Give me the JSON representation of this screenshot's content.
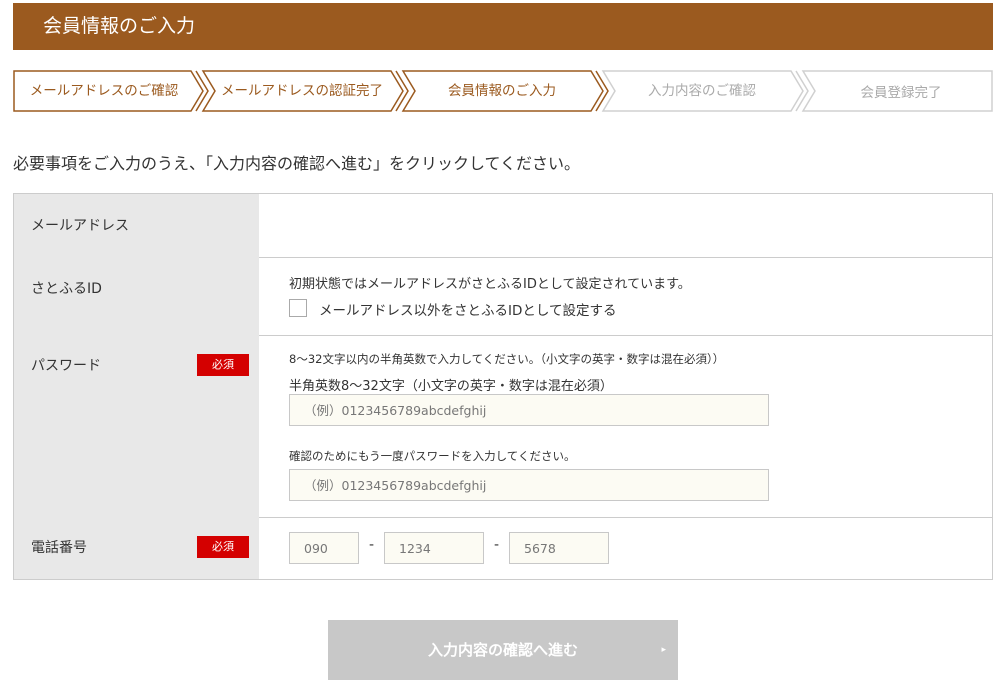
{
  "header": {
    "title": "会員情報のご入力"
  },
  "steps": [
    {
      "label": "メールアドレスのご確認",
      "state": "done"
    },
    {
      "label": "メールアドレスの認証完了",
      "state": "done"
    },
    {
      "label": "会員情報のご入力",
      "state": "current"
    },
    {
      "label": "入力内容のご確認",
      "state": "pending"
    },
    {
      "label": "会員登録完了",
      "state": "pending"
    }
  ],
  "intro": "必要事項をご入力のうえ、「入力内容の確認へ進む」をクリックしてください。",
  "form": {
    "email": {
      "label": "メールアドレス",
      "value": ""
    },
    "satofuru_id": {
      "label": "さとふるID",
      "note": "初期状態ではメールアドレスがさとふるIDとして設定されています。",
      "checkbox_label": "メールアドレス以外をさとふるIDとして設定する"
    },
    "password": {
      "label": "パスワード",
      "required": "必須",
      "note": "8～32文字以内の半角英数で入力してください。（小文字の英字・数字は混在必須））",
      "rule": "半角英数8～32文字（小文字の英字・数字は混在必須）",
      "placeholder": "（例）0123456789abcdefghij",
      "confirm_note": "確認のためにもう一度パスワードを入力してください。",
      "confirm_placeholder": "（例）0123456789abcdefghij"
    },
    "phone": {
      "label": "電話番号",
      "required": "必須",
      "placeholder_1": "090",
      "placeholder_2": "1234",
      "placeholder_3": "5678",
      "separator": "-"
    }
  },
  "submit": {
    "label": "入力内容の確認へ進む",
    "arrow": "▸"
  },
  "colors": {
    "brand": "#9b5a1f",
    "required": "#d40000",
    "pending_step": "#d0d0d0",
    "button_disabled": "#c8c8c8"
  }
}
